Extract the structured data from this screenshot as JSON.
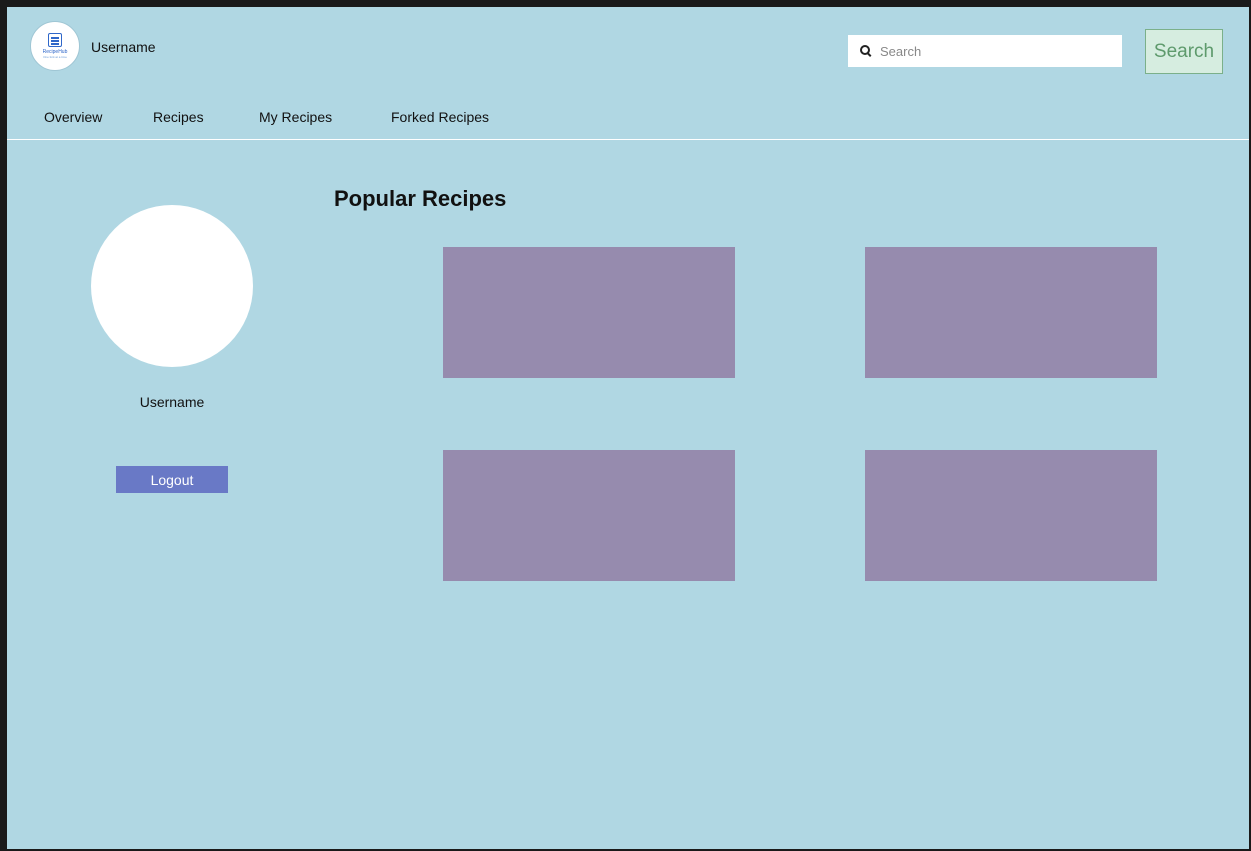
{
  "header": {
    "logo": {
      "name": "RecipeHub",
      "tagline": "One fork at a time"
    },
    "username": "Username",
    "search": {
      "placeholder": "Search",
      "value": ""
    },
    "search_button_label": "Search"
  },
  "nav": {
    "items": [
      {
        "label": "Overview"
      },
      {
        "label": "Recipes"
      },
      {
        "label": "My Recipes"
      },
      {
        "label": "Forked Recipes"
      }
    ]
  },
  "profile": {
    "username": "Username",
    "logout_label": "Logout"
  },
  "main": {
    "section_title": "Popular Recipes",
    "recipe_cards": [
      {},
      {},
      {},
      {}
    ]
  },
  "colors": {
    "background": "#b0d7e3",
    "card": "#968bae",
    "logout_button": "#6979c6",
    "search_button_bg": "#d6ede0",
    "search_button_text": "#5e9a6c"
  }
}
